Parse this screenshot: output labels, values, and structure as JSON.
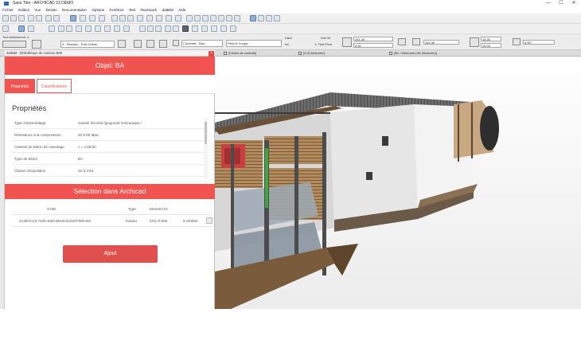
{
  "window": {
    "title": "Sans Titre - ARCHICAD 23 DEMO",
    "min": "—",
    "max": "☐",
    "close": "✕"
  },
  "menu": [
    "Fichier",
    "Edition",
    "Vue",
    "Dessin",
    "Documentation",
    "Options",
    "Fenêtres",
    "Test",
    "Teamwork",
    "datBIM",
    "Aide"
  ],
  "infobox": {
    "selection_label": "Tout sélectionné: 4",
    "layer_value": "4 - Structur... Port.Colum",
    "building_material": "Concrete - Stru...",
    "floor_plan": "Plan et Coupe...",
    "top_label": "Haut:",
    "bottom_label": "Inf:",
    "home_story": "Non lié",
    "floor": "1. First Floor",
    "h1": "241,40",
    "h2": "0,00",
    "h3": "241,40",
    "w1": "15,00",
    "w2": "15,00",
    "angle": "0,00°"
  },
  "tabs": [
    "[Centre de contrôle]",
    "[4.0] Welcome]",
    "[3D / Welcome (3D Welcome)]"
  ],
  "palette": {
    "title": "datBIM - bibliothèque de contenu BIM",
    "close": "×",
    "header": "Objet: BA",
    "tabs": [
      {
        "label": "Propriétés",
        "active": true
      },
      {
        "label": "Classifications",
        "active": false
      }
    ],
    "props_title": "Propriétés",
    "props": [
      {
        "k": "Type d'assemblage",
        "v": "claveté /broché /goujonné /mécanique /"
      },
      {
        "k": "Résistance à la compression",
        "v": "20 à 60 Mpa"
      },
      {
        "k": "Classes de béton de clavetage",
        "v": "> = C25/30"
      },
      {
        "k": "Type de béton",
        "v": "BA"
      },
      {
        "k": "Classe d'exposition",
        "v": "X0 à XS3"
      }
    ],
    "selection_header": "Sélection dans Archicad",
    "table": {
      "headers": [
        "GUID",
        "Type",
        "Element ID"
      ],
      "row": [
        "4A3D7CC3-7429-4564-B61B-5CD2FF98FA50",
        "Poteau",
        "COL-P-006",
        "à 194003"
      ]
    },
    "add_button": "Ajout"
  }
}
